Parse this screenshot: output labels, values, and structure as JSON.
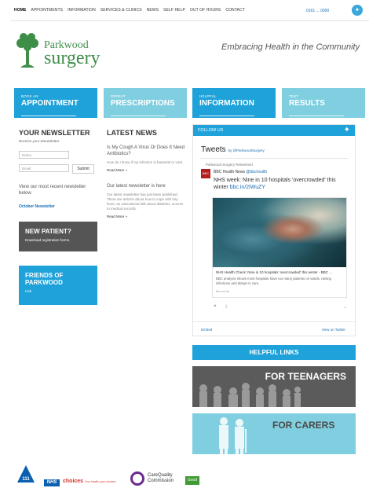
{
  "nav": {
    "items": [
      "HOME",
      "APPOINTMENTS",
      "INFORMATION",
      "SERVICES & CLINICS",
      "NEWS",
      "SELF HELP",
      "OUT OF HOURS",
      "CONTACT"
    ],
    "phone": "0161 ... 0000"
  },
  "logo": {
    "word1": "Parkwood",
    "word2": "surgery"
  },
  "tagline": "Embracing Health in the Community",
  "tiles": [
    {
      "small": "BOOK AN",
      "big": "APPOINTMENT"
    },
    {
      "small": "REPEAT",
      "big": "PRESCRIPTIONS"
    },
    {
      "small": "HELPFUL",
      "big": "INFORMATION"
    },
    {
      "small": "TEST",
      "big": "RESULTS"
    }
  ],
  "newsletter": {
    "title": "YOUR NEWSLETTER",
    "subtitle": "Receive your eNewsletter",
    "name_placeholder": "Name",
    "email_placeholder": "Email",
    "submit": "Submit",
    "view_text": "View our most recent newsletter below",
    "link": "October Newsletter"
  },
  "new_patient": {
    "title": "NEW PATIENT?",
    "sub": "Download registration forms."
  },
  "friends": {
    "title": "FRIENDS OF PARKWOOD",
    "sub": "Link"
  },
  "news": {
    "title": "LATEST NEWS",
    "items": [
      {
        "title": "Is My Cough A Virus Or Does It Need Antibiotics?",
        "desc": "How do I know if my infection is bacterial or viral.",
        "more": "Read More »"
      },
      {
        "title": "Our latest newsletter is here",
        "desc": "Our latest newsletter has just been published. There are articles about how to cope with hay fever, an educational talk about diabetes, access to medical records.",
        "more": "Read More »"
      }
    ]
  },
  "twitter": {
    "follow": "FOLLOW US",
    "tweets_title": "Tweets",
    "tweets_by": "by @ParkwoodSurgery",
    "retweeted": "Parkwood Surgery Retweeted",
    "avatar_text": "BBC",
    "author": "BBC Health News",
    "handle": "@bbchealth",
    "text": "NHS week: Nine in 10 hospitals 'overcrowded' this winter",
    "link": "bbc.in/2iWuZY",
    "card_title": "NHS Health Check: Nine in 10 hospitals 'overcrowded' this winter - BBC ...",
    "card_desc": "BBC analysis shows most hospitals have too many patients on wards, raising infections and delays in care.",
    "card_domain": "bbc.co.uk",
    "embed": "Embed",
    "view": "View on Twitter"
  },
  "helpful": {
    "title": "HELPFUL LINKS",
    "teens": "FOR TEENAGERS",
    "carers": "FOR CARERS"
  },
  "footer": {
    "nhs": "NHS",
    "choices": "choices",
    "choices_sub": "Your health, your choices",
    "cqc": "CareQuality Commission",
    "good": "Good",
    "one11": "111"
  },
  "colors": {
    "blue": "#1ea2d9",
    "light_blue": "#80cfe0",
    "grey": "#5b5b5b",
    "green": "#3e8e49"
  }
}
